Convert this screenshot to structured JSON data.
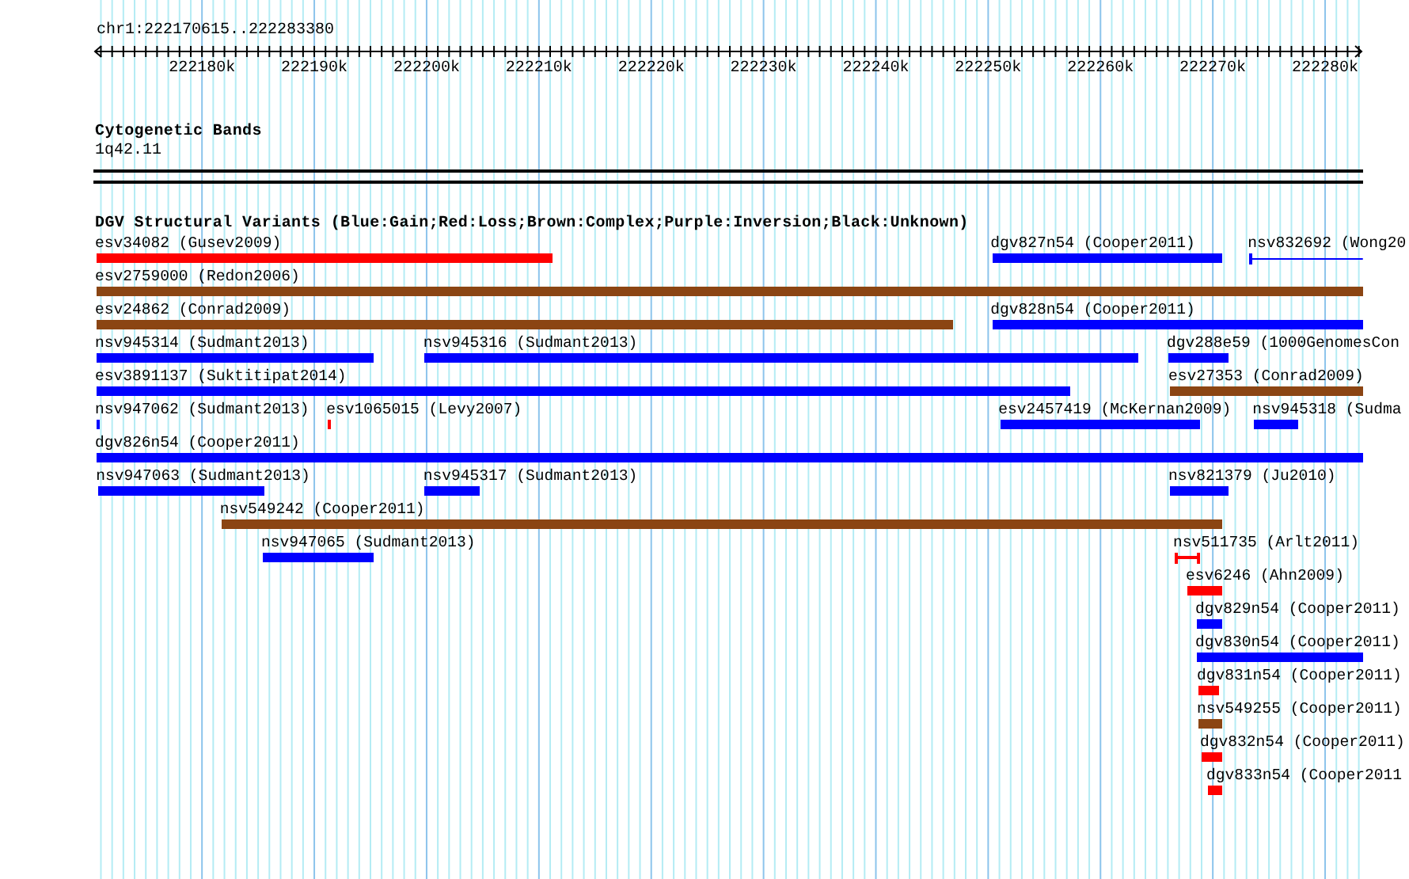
{
  "view": {
    "title": "chr1:222170615..222283380"
  },
  "ruler": {
    "ticks": [
      "222180k",
      "222190k",
      "222200k",
      "222210k",
      "222220k",
      "222230k",
      "222240k",
      "222250k",
      "222260k",
      "222270k",
      "222280k"
    ]
  },
  "cytogenetic_bands": {
    "title": "Cytogenetic Bands",
    "band": "1q42.11"
  },
  "dgv_track": {
    "title": "DGV Structural Variants (Blue:Gain;Red:Loss;Brown:Complex;Purple:Inversion;Black:Unknown)",
    "rows": [
      [
        {
          "label": "esv34082 (Gusev2009)",
          "kind": "bar",
          "color": "#ff0000"
        },
        {
          "label": "dgv827n54 (Cooper2011)",
          "kind": "bar",
          "color": "#0000ff"
        },
        {
          "label": "nsv832692 (Wong20",
          "kind": "line",
          "color": "#0000ff"
        }
      ],
      [
        {
          "label": "esv2759000 (Redon2006)",
          "kind": "bar",
          "color": "#8b4513"
        }
      ],
      [
        {
          "label": "esv24862 (Conrad2009)",
          "kind": "bar",
          "color": "#8b4513"
        },
        {
          "label": "dgv828n54 (Cooper2011)",
          "kind": "bar",
          "color": "#0000ff"
        }
      ],
      [
        {
          "label": "nsv945314 (Sudmant2013)",
          "kind": "bar",
          "color": "#0000ff"
        },
        {
          "label": "nsv945316 (Sudmant2013)",
          "kind": "bar",
          "color": "#0000ff"
        },
        {
          "label": "dgv288e59 (1000GenomesCon",
          "kind": "bar",
          "color": "#0000ff"
        }
      ],
      [
        {
          "label": "esv3891137 (Suktitipat2014)",
          "kind": "bar",
          "color": "#0000ff"
        },
        {
          "label": "esv27353 (Conrad2009)",
          "kind": "bar",
          "color": "#8b4513"
        }
      ],
      [
        {
          "label": "nsv947062 (Sudmant2013)",
          "kind": "bar",
          "color": "#0000ff"
        },
        {
          "label": "esv1065015 (Levy2007)",
          "kind": "bar",
          "color": "#ff0000"
        },
        {
          "label": "esv2457419 (McKernan2009)",
          "kind": "bar",
          "color": "#0000ff"
        },
        {
          "label": "nsv945318 (Sudma",
          "kind": "bar",
          "color": "#0000ff"
        }
      ],
      [
        {
          "label": "dgv826n54 (Cooper2011)",
          "kind": "bar",
          "color": "#0000ff"
        }
      ],
      [
        {
          "label": "nsv947063 (Sudmant2013)",
          "kind": "bar",
          "color": "#0000ff"
        },
        {
          "label": "nsv945317 (Sudmant2013)",
          "kind": "bar",
          "color": "#0000ff"
        },
        {
          "label": "nsv821379 (Ju2010)",
          "kind": "bar",
          "color": "#0000ff"
        }
      ],
      [
        {
          "label": "nsv549242 (Cooper2011)",
          "kind": "bar",
          "color": "#8b4513"
        }
      ],
      [
        {
          "label": "nsv947065 (Sudmant2013)",
          "kind": "bar",
          "color": "#0000ff"
        },
        {
          "label": "nsv511735 (Arlt2011)",
          "kind": "interval",
          "color": "#ff0000"
        }
      ],
      [
        {
          "label": "esv6246 (Ahn2009)",
          "kind": "bar",
          "color": "#ff0000"
        }
      ],
      [
        {
          "label": "dgv829n54 (Cooper2011)",
          "kind": "bar",
          "color": "#0000ff"
        }
      ],
      [
        {
          "label": "dgv830n54 (Cooper2011)",
          "kind": "bar",
          "color": "#0000ff"
        }
      ],
      [
        {
          "label": "dgv831n54 (Cooper2011)",
          "kind": "bar",
          "color": "#ff0000"
        }
      ],
      [
        {
          "label": "nsv549255 (Cooper2011)",
          "kind": "bar",
          "color": "#8b4513"
        }
      ],
      [
        {
          "label": "dgv832n54 (Cooper2011)",
          "kind": "bar",
          "color": "#ff0000"
        }
      ],
      [
        {
          "label": "dgv833n54 (Cooper2011",
          "kind": "bar",
          "color": "#ff0000"
        }
      ]
    ]
  }
}
